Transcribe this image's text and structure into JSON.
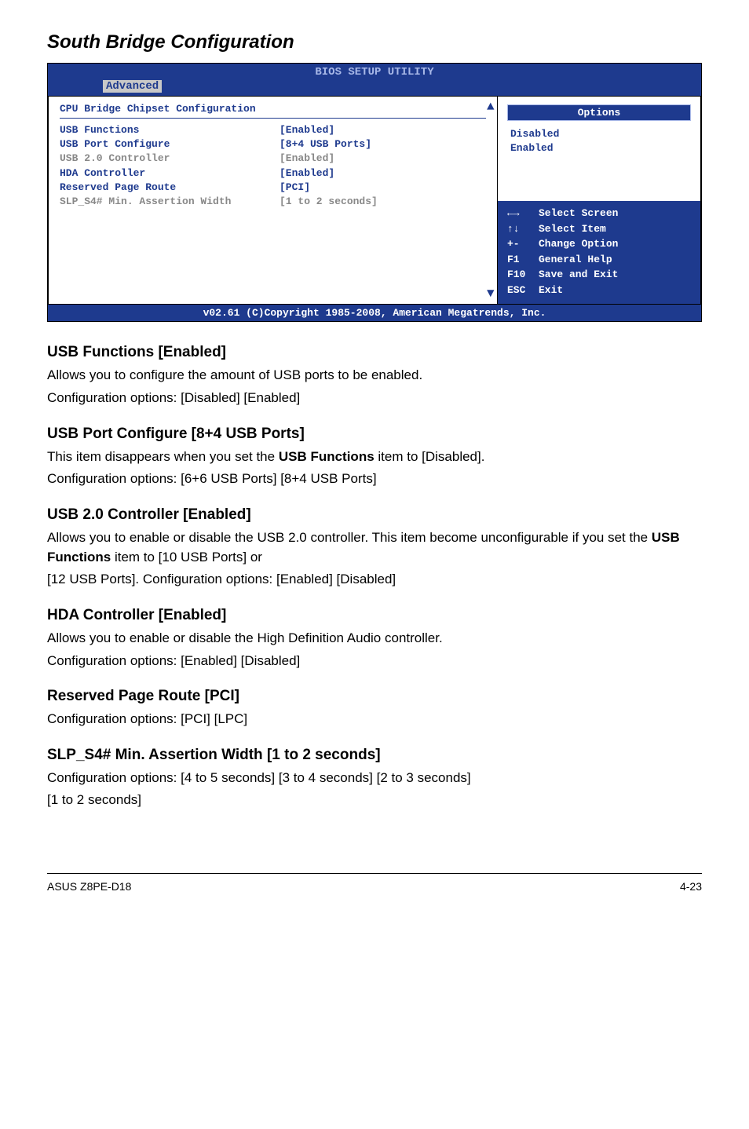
{
  "sectionTitle": "South Bridge Configuration",
  "bios": {
    "headerTitle": "BIOS SETUP UTILITY",
    "activeTab": "Advanced",
    "panelTitle": "CPU Bridge Chipset Configuration",
    "rows": [
      {
        "label": "USB Functions",
        "value": "[Enabled]",
        "cls": ""
      },
      {
        "label": "USB Port Configure",
        "value": "[8+4 USB Ports]",
        "cls": ""
      },
      {
        "label": "USB 2.0 Controller",
        "value": "[Enabled]",
        "cls": "gray"
      },
      {
        "label": "HDA Controller",
        "value": "[Enabled]",
        "cls": ""
      },
      {
        "label": "Reserved Page Route",
        "value": "[PCI]",
        "cls": ""
      },
      {
        "label": "",
        "value": "",
        "cls": ""
      },
      {
        "label": "SLP_S4# Min. Assertion Width",
        "value": "[1 to 2 seconds]",
        "cls": "gray"
      }
    ],
    "optionsTitle": "Options",
    "optionsList": [
      "Disabled",
      "Enabled"
    ],
    "help": [
      {
        "key": "←→",
        "text": "Select Screen"
      },
      {
        "key": "↑↓",
        "text": "Select Item"
      },
      {
        "key": "+-",
        "text": "Change Option"
      },
      {
        "key": "F1",
        "text": "General Help"
      },
      {
        "key": "F10",
        "text": "Save and Exit"
      },
      {
        "key": "ESC",
        "text": "Exit"
      }
    ],
    "footer": "v02.61 (C)Copyright 1985-2008, American Megatrends, Inc."
  },
  "sub1": {
    "title": "USB Functions [Enabled]",
    "line1": "Allows you to configure the amount of USB ports to be enabled.",
    "line2": "Configuration options: [Disabled] [Enabled]"
  },
  "sub2": {
    "title": "USB Port Configure [8+4 USB Ports]",
    "prefix": "This item disappears when you set the ",
    "bold": "USB Functions",
    "suffix": " item to [Disabled].",
    "line2": "Configuration options: [6+6 USB Ports] [8+4 USB Ports]"
  },
  "sub3": {
    "title": "USB 2.0 Controller [Enabled]",
    "line1a": "Allows you to enable or disable the USB 2.0 controller. This item become unconfigurable if you set the ",
    "bold": "USB Functions",
    "line1b": " item to [10 USB Ports] or",
    "line2": "[12 USB Ports]. Configuration options: [Enabled] [Disabled]"
  },
  "sub4": {
    "title": "HDA Controller [Enabled]",
    "line1": "Allows you to enable or disable the High Definition Audio controller.",
    "line2": "Configuration options: [Enabled] [Disabled]"
  },
  "sub5": {
    "title": "Reserved Page Route [PCI]",
    "line1": "Configuration options: [PCI] [LPC]"
  },
  "sub6": {
    "title": "SLP_S4# Min. Assertion Width [1 to 2 seconds]",
    "line1": "Configuration options: [4 to 5 seconds] [3 to 4 seconds] [2 to 3 seconds]",
    "line2": "[1 to 2 seconds]"
  },
  "footerLeft": "ASUS Z8PE-D18",
  "footerRight": "4-23"
}
